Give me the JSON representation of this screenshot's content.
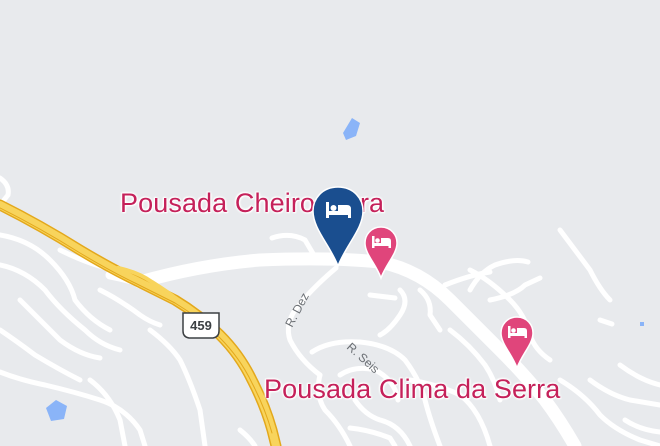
{
  "map": {
    "background_color": "#e8eaed",
    "road_color": "#ffffff",
    "highway_color": "#f5c542",
    "water_color": "#8ab4f8",
    "selected_pin_color": "#1a4e8f",
    "poi_color": "#e0457b"
  },
  "places": [
    {
      "name": "Pousada Cheiro da Terra",
      "visible_text": "Pousada Cheiro   Terra",
      "icon": "hotel-bed-icon",
      "selected": true
    },
    {
      "name": "Pousada Cheiro da Terra (nearby marker)",
      "icon": "hotel-bed-icon",
      "selected": false
    },
    {
      "name": "Pousada Clima da Serra",
      "visible_text": "Pousada Clima da Serra",
      "icon": "hotel-bed-icon",
      "selected": false
    }
  ],
  "labels": {
    "cheiro": "Pousada Cheiro   Terra",
    "clima": "Pousada Clima da Serra"
  },
  "streets": {
    "r_dez": "R. Dez",
    "r_seis": "R. Seis"
  },
  "highway_shield": "459"
}
